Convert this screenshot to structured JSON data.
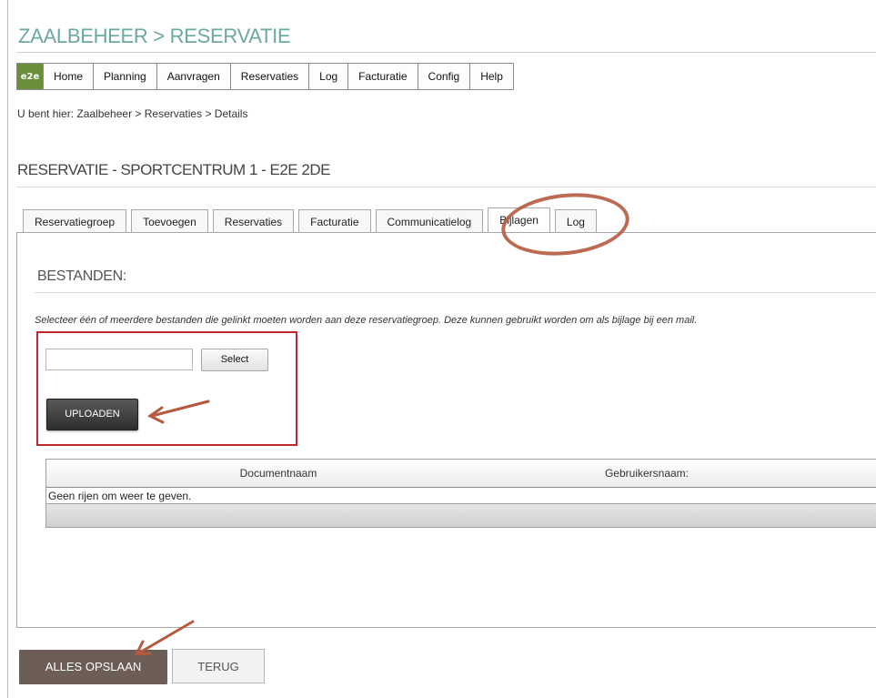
{
  "app": {
    "title": "ZAALBEHEER > RESERVATIE",
    "logo_text": "e2e"
  },
  "menu": {
    "items": [
      "Home",
      "Planning",
      "Aanvragen",
      "Reservaties",
      "Log",
      "Facturatie",
      "Config",
      "Help"
    ]
  },
  "breadcrumb": "U bent hier: Zaalbeheer > Reservaties > Details",
  "page_title": "RESERVATIE - SPORTCENTRUM 1 - E2E 2DE",
  "tabs": [
    "Reservatiegroep",
    "Toevoegen",
    "Reservaties",
    "Facturatie",
    "Communicatielog",
    "Bijlagen",
    "Log"
  ],
  "active_tab": "Bijlagen",
  "attachments": {
    "section_title": "BESTANDEN:",
    "instruction": "Selecteer één of meerdere bestanden die gelinkt moeten worden aan deze reservatiegroep. Deze kunnen gebruikt worden om als bijlage bij een mail.",
    "file_input_value": "",
    "select_label": "Select",
    "upload_label": "UPLOADEN",
    "grid": {
      "columns": [
        "Documentnaam",
        "Gebruikersnaam:"
      ],
      "empty_text": "Geen rijen om weer te geven."
    }
  },
  "footer": {
    "save_label": "ALLES OPSLAAN",
    "back_label": "TERUG"
  },
  "colors": {
    "title": "#6aa9a0",
    "annotation_red": "#c0282e",
    "annotation_brown": "#b55a3f",
    "save_button": "#6d5d57"
  }
}
